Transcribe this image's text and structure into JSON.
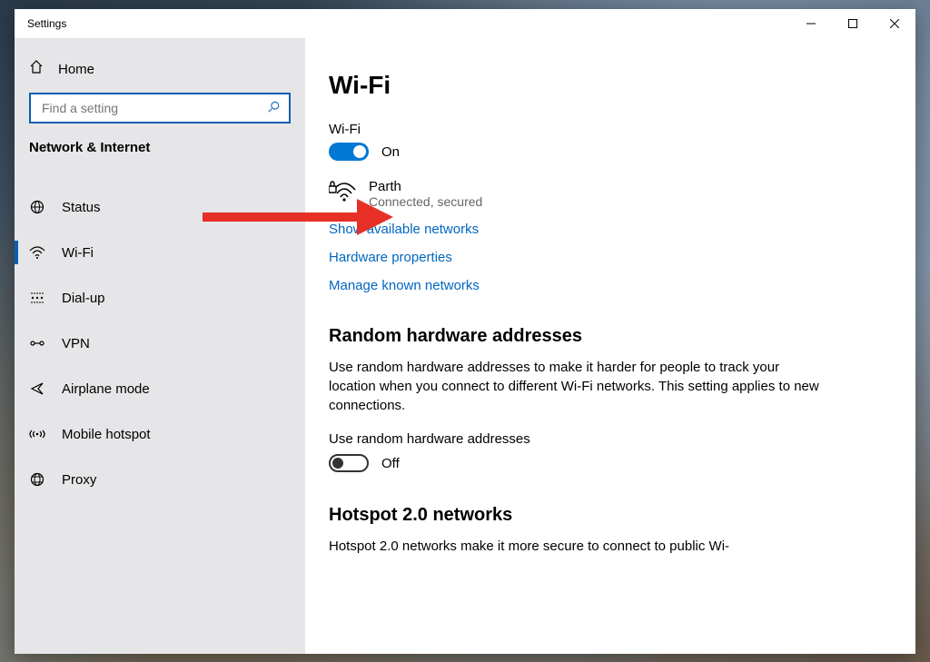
{
  "window": {
    "title": "Settings"
  },
  "sidebar": {
    "home_label": "Home",
    "search_placeholder": "Find a setting",
    "group_title": "Network & Internet",
    "items": [
      {
        "label": "Status"
      },
      {
        "label": "Wi-Fi"
      },
      {
        "label": "Dial-up"
      },
      {
        "label": "VPN"
      },
      {
        "label": "Airplane mode"
      },
      {
        "label": "Mobile hotspot"
      },
      {
        "label": "Proxy"
      }
    ],
    "active_index": 1
  },
  "main": {
    "page_title": "Wi-Fi",
    "wifi_label": "Wi-Fi",
    "wifi_toggle_state": "On",
    "network_name": "Parth",
    "network_status": "Connected, secured",
    "links": {
      "show_available": "Show available networks",
      "hardware_props": "Hardware properties",
      "manage_known": "Manage known networks"
    },
    "random_section": {
      "heading": "Random hardware addresses",
      "body": "Use random hardware addresses to make it harder for people to track your location when you connect to different Wi-Fi networks. This setting applies to new connections.",
      "label": "Use random hardware addresses",
      "state": "Off"
    },
    "hotspot_section": {
      "heading": "Hotspot 2.0 networks",
      "body_start": "Hotspot 2.0 networks make it more secure to connect to public Wi-"
    }
  }
}
